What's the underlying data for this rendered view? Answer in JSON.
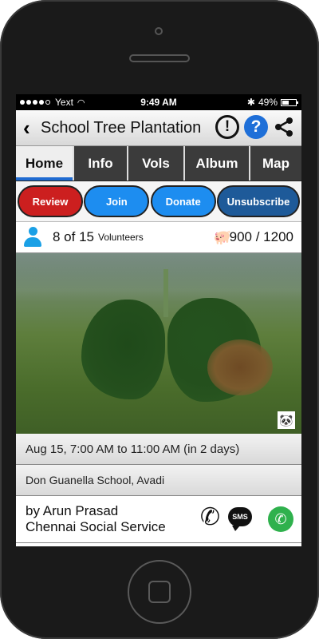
{
  "status_bar": {
    "carrier": "Yext",
    "time": "9:49 AM",
    "bluetooth": "✱",
    "battery": "49%"
  },
  "header": {
    "title": "School Tree Plantation",
    "icons": [
      "back-icon",
      "alert-icon",
      "help-icon",
      "share-icon"
    ]
  },
  "tabs": [
    {
      "label": "Home",
      "active": true
    },
    {
      "label": "Info",
      "active": false
    },
    {
      "label": "Vols",
      "active": false
    },
    {
      "label": "Album",
      "active": false
    },
    {
      "label": "Map",
      "active": false
    }
  ],
  "actions": {
    "review": "Review",
    "join": "Join",
    "donate": "Donate",
    "unsubscribe": "Unsubscribe"
  },
  "volunteers": {
    "count": "8 of 15",
    "label": "Volunteers",
    "funds": "900 / 1200"
  },
  "event": {
    "date": "Aug 15, 7:00 AM to 11:00 AM (in 2 days)",
    "place": "Don Guanella School, Avadi"
  },
  "organizer": {
    "by": "by Arun Prasad",
    "org": "Chennai Social Service"
  },
  "photo_badge": "🐼",
  "colors": {
    "review": "#cc1f1f",
    "join": "#1d8df0",
    "donate": "#1d8df0",
    "unsubscribe": "#1e5a99",
    "tab_active_underline": "#1f6bd1",
    "whatsapp": "#2fb14d"
  }
}
